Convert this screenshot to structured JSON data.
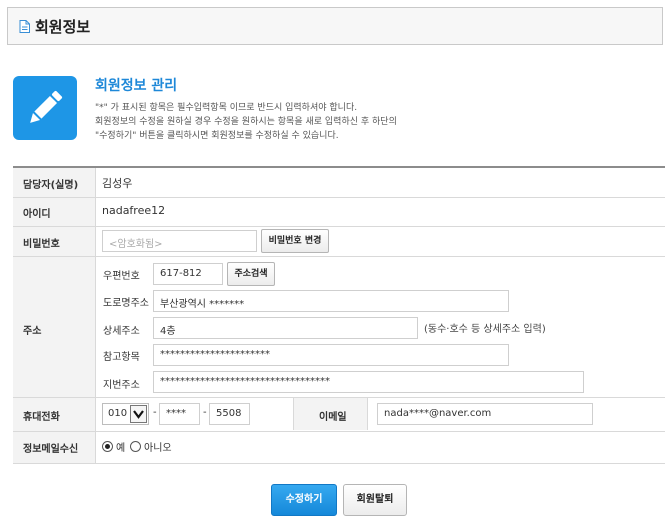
{
  "page": {
    "title": "회원정보"
  },
  "intro": {
    "title": "회원정보 관리",
    "lines": [
      "\"*\" 가 표시된 항목은 필수입력항목 이므로 반드시 입력하셔야 합니다.",
      "회원정보의 수정을 원하실 경우 수정을 원하시는 항목을 새로 입력하신 후 하단의",
      "\"수정하기\" 버튼을 클릭하시면 회원정보를 수정하실 수 있습니다."
    ]
  },
  "form": {
    "manager": {
      "label": "담당자(실명)",
      "value": "김성우"
    },
    "userid": {
      "label": "아이디",
      "value": "nadafree12"
    },
    "password": {
      "label": "비밀번호",
      "placeholder": "<암호화됨>",
      "change_button": "비밀번호 변경"
    },
    "address": {
      "label": "주소",
      "postcode_label": "우편번호",
      "postcode": "617-812",
      "search_button": "주소검색",
      "road_label": "도로명주소",
      "road": "부산광역시 *******",
      "detail_label": "상세주소",
      "detail": "4층",
      "detail_note": "(동수·호수 등 상세주소 입력)",
      "ref_label": "참고항목",
      "ref": "**********************",
      "jibun_label": "지번주소",
      "jibun": "**********************************"
    },
    "phone": {
      "label": "휴대전화",
      "area": "010",
      "sep": "-",
      "mid": "****",
      "last": "5508"
    },
    "email": {
      "label": "이메일",
      "value": "nada****@naver.com"
    },
    "mailing": {
      "label": "정보메일수신",
      "yes": "예",
      "no": "아니오",
      "selected": "yes"
    }
  },
  "actions": {
    "save": "수정하기",
    "withdraw": "회원탈퇴"
  },
  "colors": {
    "accent": "#1e96e6",
    "primary_button": "#1e90e0"
  }
}
